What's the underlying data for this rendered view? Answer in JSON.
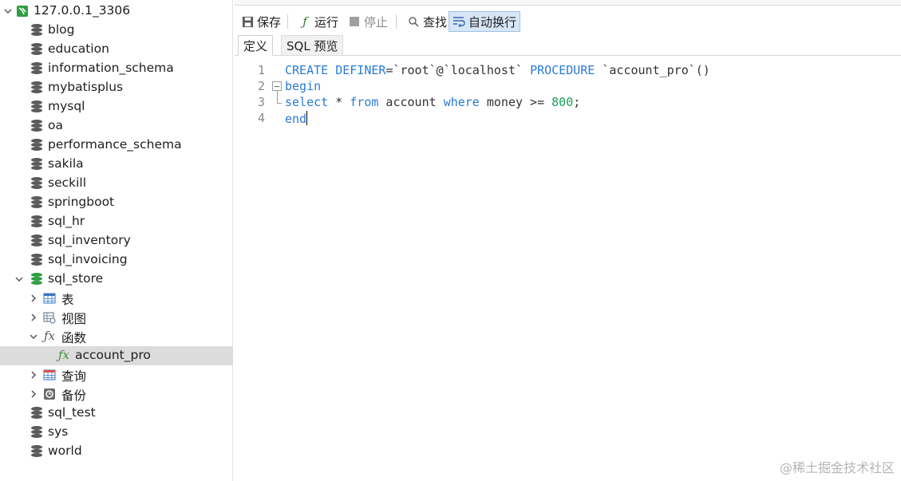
{
  "tree": {
    "connection": "127.0.0.1_3306",
    "databases_top": [
      "blog",
      "education",
      "information_schema",
      "mybatisplus",
      "mysql",
      "oa",
      "performance_schema",
      "sakila",
      "seckill",
      "springboot",
      "sql_hr",
      "sql_inventory",
      "sql_invoicing"
    ],
    "open_db": "sql_store",
    "children": {
      "tables": "表",
      "views": "视图",
      "functions": "函数",
      "function_item": "account_pro",
      "queries": "查询",
      "backups": "备份"
    },
    "databases_bottom": [
      "sql_test",
      "sys",
      "world"
    ]
  },
  "toolbar": {
    "save": "保存",
    "run": "运行",
    "stop": "停止",
    "find": "查找",
    "wrap": "自动换行"
  },
  "tabs": {
    "definition": "定义",
    "sql_preview": "SQL 预览"
  },
  "editor": {
    "line_numbers": [
      "1",
      "2",
      "3",
      "4"
    ],
    "line1": {
      "kw1": "CREATE DEFINER",
      "t1": "=`root`@`localhost` ",
      "kw2": "PROCEDURE",
      "t2": " `account_pro`()"
    },
    "line2": {
      "kw1": "begin"
    },
    "line3": {
      "kw1": "select",
      "t1": " * ",
      "kw2": "from",
      "t2": " account ",
      "kw3": "where",
      "t3": " money >= ",
      "num": "800",
      "t4": ";"
    },
    "line4": {
      "kw1": "end"
    }
  },
  "watermark": "@稀土掘金技术社区",
  "colors": {
    "keyword": "#2a7bd6",
    "number": "#18a058",
    "selected_row": "#dcdcdc",
    "db_open": "#2f9e44"
  }
}
